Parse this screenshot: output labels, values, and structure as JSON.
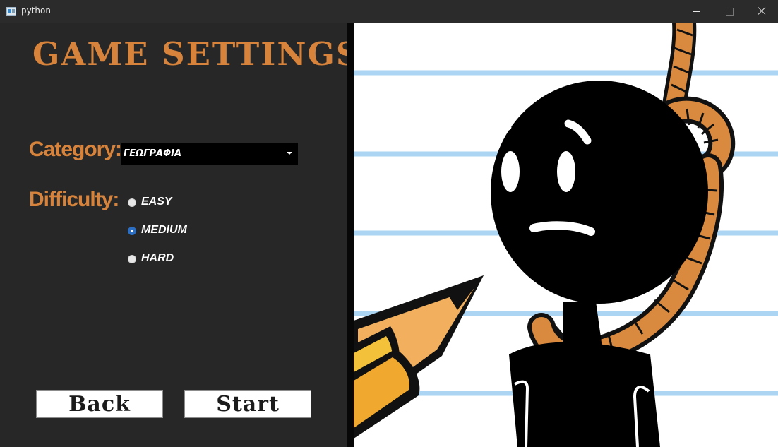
{
  "window": {
    "title": "python",
    "icon": "python-window-icon",
    "controls": [
      "minimize-icon",
      "maximize-icon",
      "close-icon"
    ]
  },
  "settings": {
    "title": "GAME SETTINGS",
    "category": {
      "label": "Category:",
      "selected": "ΓΕΩΓΡΑΦΙΑ"
    },
    "difficulty": {
      "label": "Difficulty:",
      "options": [
        "EASY",
        "MEDIUM",
        "HARD"
      ],
      "selected": "MEDIUM"
    },
    "buttons": {
      "back": "Back",
      "start": "Start"
    }
  },
  "colors": {
    "accent": "#d7833b",
    "panel": "#272727",
    "radio_selected": "#2b6fc5"
  },
  "illustration": {
    "name": "hanging-stickman-image"
  }
}
